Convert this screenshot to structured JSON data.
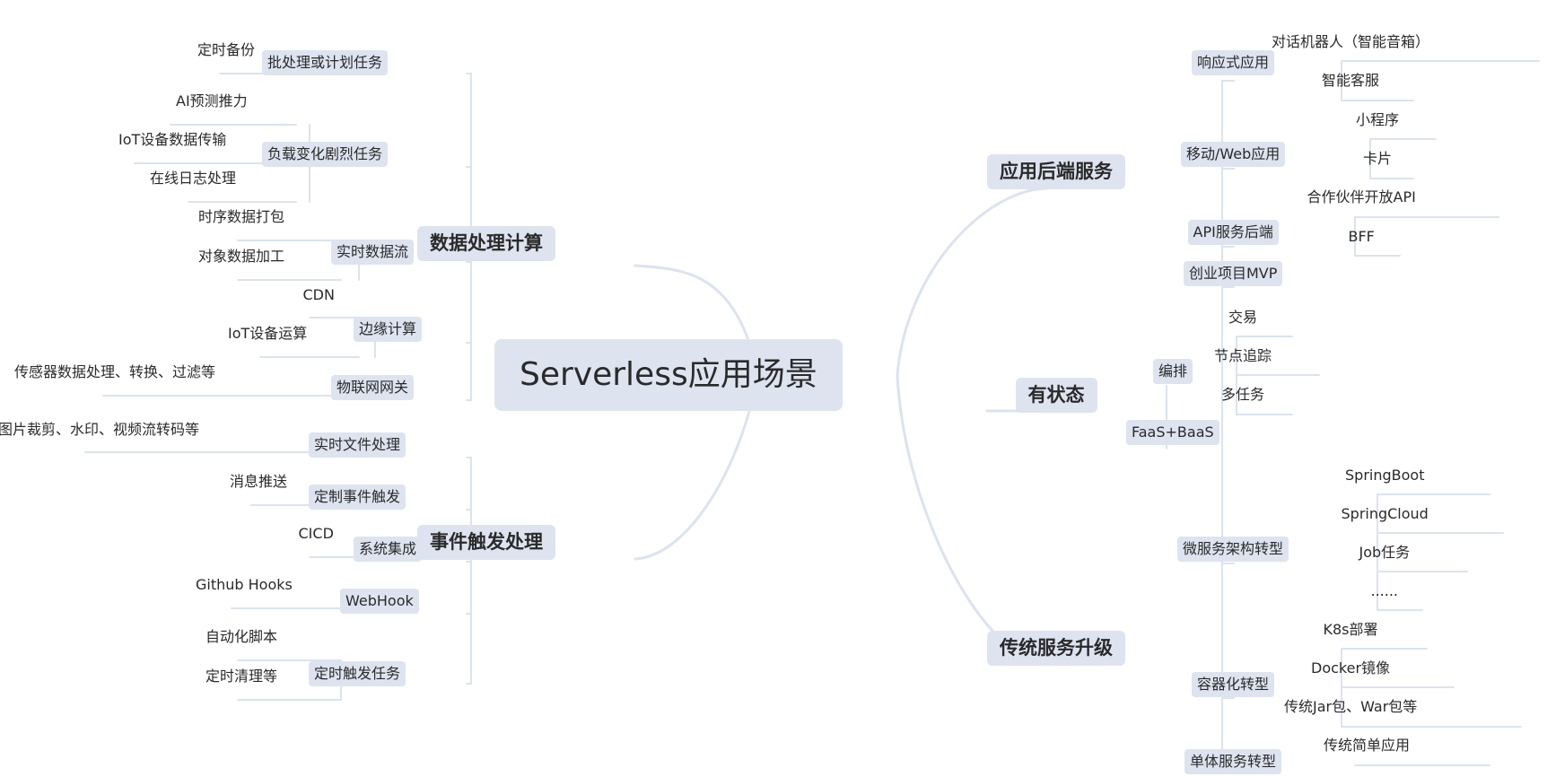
{
  "root": "Serverless应用场景",
  "main": {
    "data_processing": "数据处理计算",
    "event_trigger": "事件触发处理",
    "backend": "应用后端服务",
    "stateful": "有状态",
    "legacy": "传统服务升级"
  },
  "sub": {
    "batch": "批处理或计划任务",
    "load": "负载变化剧烈任务",
    "stream": "实时数据流",
    "edge": "边缘计算",
    "iot_gw": "物联网网关",
    "file": "实时文件处理",
    "custom_event": "定制事件触发",
    "integration": "系统集成",
    "webhook": "WebHook",
    "cron": "定时触发任务",
    "reactive": "响应式应用",
    "mobile": "移动/Web应用",
    "api": "API服务后端",
    "mvp": "创业项目MVP",
    "orchestrate": "编排",
    "faas": "FaaS+BaaS",
    "micro": "微服务架构转型",
    "container": "容器化转型",
    "monolith": "单体服务转型"
  },
  "leaf": {
    "backup": "定时备份",
    "ai": "AI预测推力",
    "iot_data": "IoT设备数据传输",
    "log": "在线日志处理",
    "ts": "时序数据打包",
    "obj": "对象数据加工",
    "cdn": "CDN",
    "iot_op": "IoT设备运算",
    "sensor": "传感器数据处理、转换、过滤等",
    "image": "图片裁剪、水印、视频流转码等",
    "push": "消息推送",
    "cicd": "CICD",
    "gh": "Github Hooks",
    "script": "自动化脚本",
    "cleanup": "定时清理等",
    "chatbot": "对话机器人（智能音箱）",
    "cs": "智能客服",
    "miniapp": "小程序",
    "card": "卡片",
    "partner": "合作伙伴开放API",
    "bff": "BFF",
    "trade": "交易",
    "trace": "节点追踪",
    "multi": "多任务",
    "springboot": "SpringBoot",
    "springcloud": "SpringCloud",
    "job": "Job任务",
    "more": "......",
    "k8s": "K8s部署",
    "docker": "Docker镜像",
    "jar": "传统Jar包、War包等",
    "simple": "传统简单应用"
  }
}
